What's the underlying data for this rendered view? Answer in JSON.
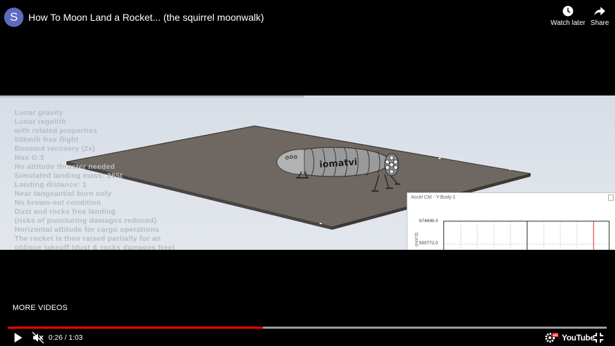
{
  "header": {
    "channel_initial": "S",
    "title": "How To Moon Land a Rocket... (the squirrel moonwalk)",
    "actions": [
      {
        "label": "Watch later",
        "icon": "clock-icon"
      },
      {
        "label": "Share",
        "icon": "share-arrow-icon"
      }
    ]
  },
  "video": {
    "overlay_lines": [
      "Lunar gravity",
      "Lunar regolith",
      "with related properties",
      "50km/h free flight",
      "Boosted recovery (2x)",
      "Max G:3",
      "No attitude thruster needed",
      "Simulated landing mass: 265t",
      "Landing distance: 1",
      "Near tangeantial burn only",
      "No brown-out condition",
      "Dust and rocks free landing",
      "(risks of puncturing damages reduced)",
      "Horizontal attitude for cargo operations",
      "The rocket is then raised partially for an",
      "oblique takeoff (dust & rocks damages free)"
    ],
    "rocket_label": "iomatvi",
    "plot": {
      "title": "Accel CM - Y-Body-1",
      "y_ticks": [
        "674696.0",
        "505772.0"
      ],
      "y_unit": "(m/s^2)"
    }
  },
  "more_videos_label": "MORE VIDEOS",
  "player": {
    "progress_fraction": 0.426,
    "buffer_fraction": 1.0,
    "time_display": "0:26 / 1:03",
    "logo_text": "YouTube",
    "accent_color": "#ff0000"
  }
}
